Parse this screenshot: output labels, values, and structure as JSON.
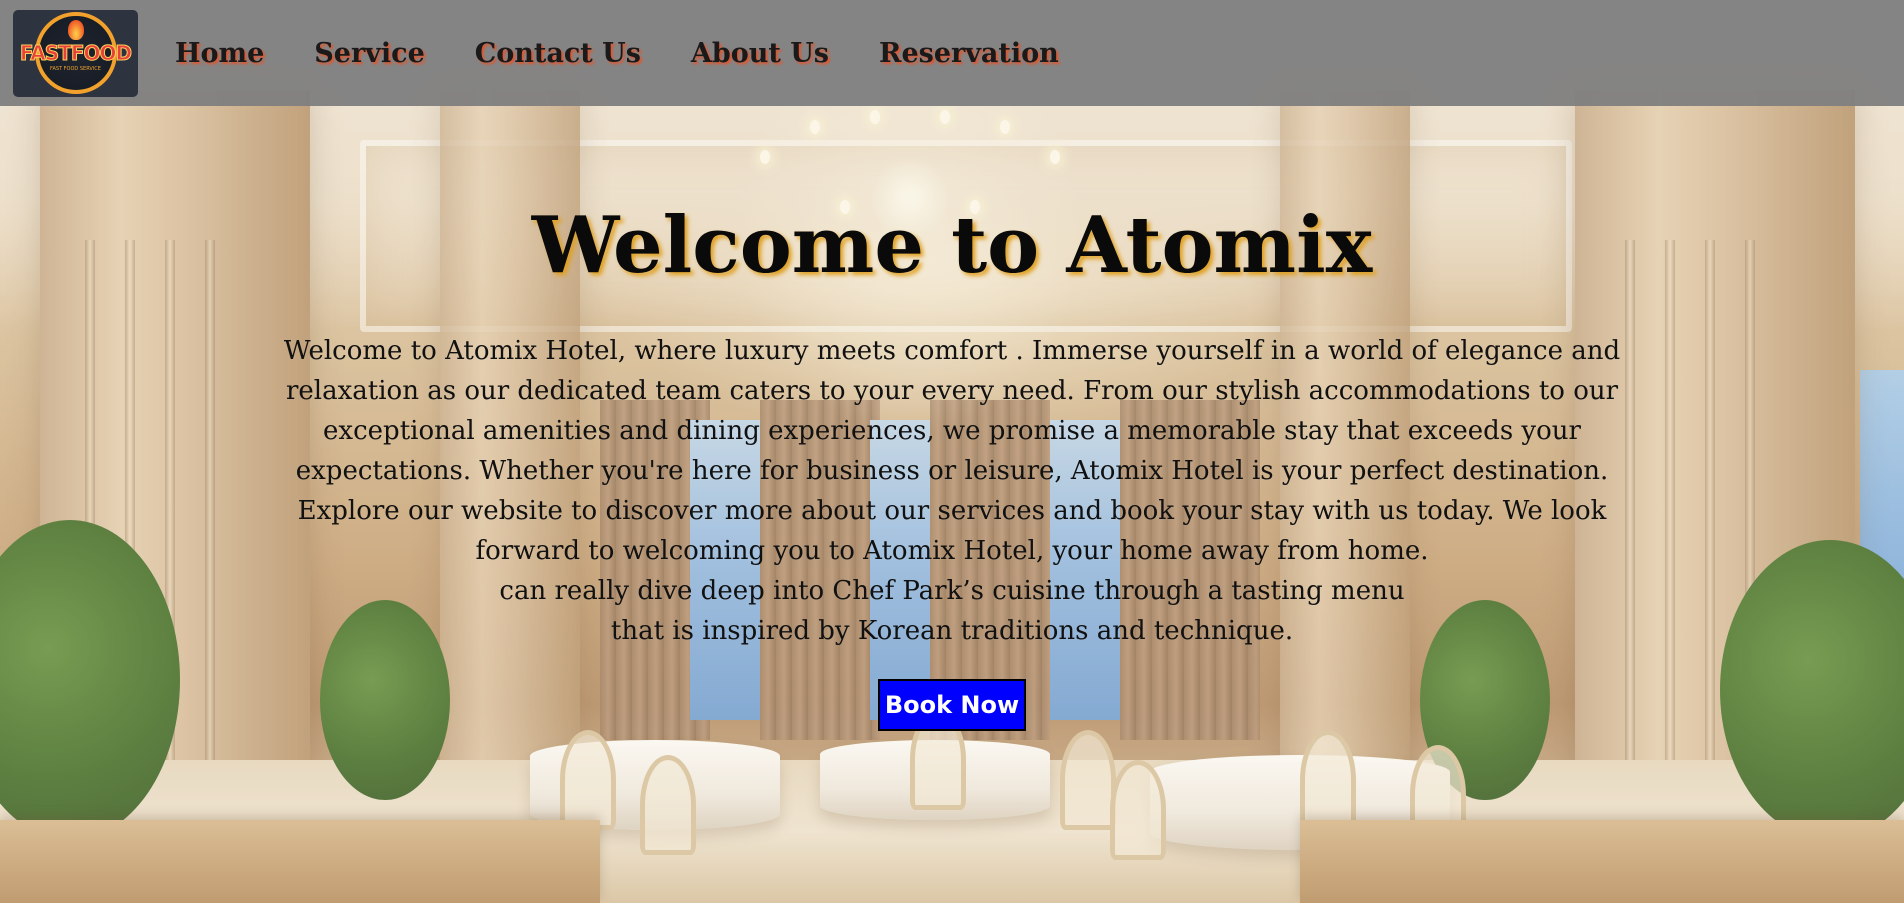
{
  "nav": {
    "logo": {
      "text": "FASTFOOD",
      "subtext": "FAST FOOD SERVICE",
      "icon": "flame-icon"
    },
    "links": [
      "Home",
      "Service",
      "Contact Us",
      "About Us",
      "Reservation"
    ]
  },
  "hero": {
    "title": "Welcome to Atomix",
    "lines": [
      "Welcome to Atomix Hotel, where luxury meets comfort . Immerse yourself in a world of elegance and",
      "relaxation as our dedicated team caters to your every need. From our stylish accommodations to our",
      "exceptional amenities and dining experiences, we promise a memorable stay that exceeds your",
      "expectations. Whether you're here for business or leisure, Atomix Hotel is your perfect destination.",
      "Explore our website to discover more about our services and book your stay with us today. We look",
      "forward to welcoming you to Atomix Hotel, your home away from home.",
      "can really dive deep into Chef Park’s cuisine through a tasting menu",
      "that is inspired by Korean traditions and technique."
    ],
    "button_label": "Book Now"
  },
  "colors": {
    "navbar": "#808080",
    "button_bg": "#0000ff",
    "button_text": "#ffffff",
    "title_shadow": "#e0a020",
    "nav_shadow": "#e0562f"
  }
}
